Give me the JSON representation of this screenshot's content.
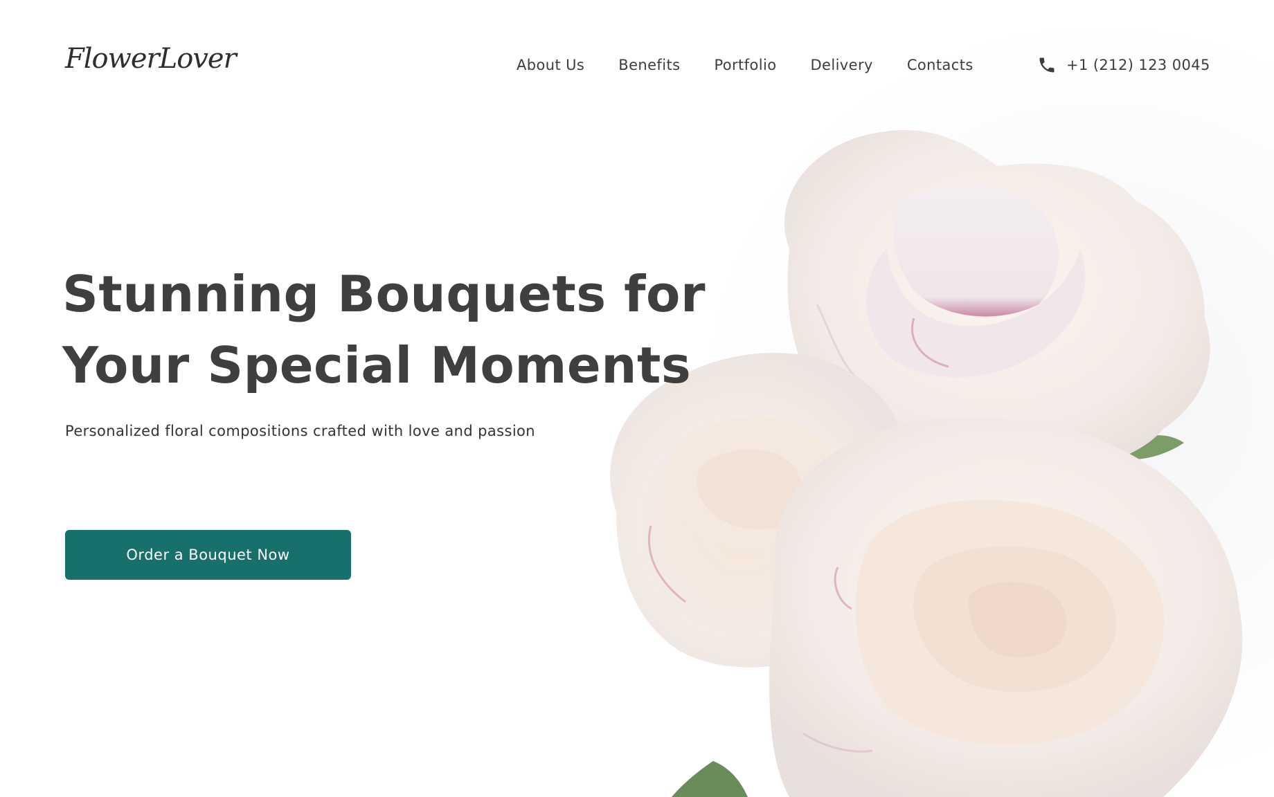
{
  "header": {
    "logo_text": "FlowerLover",
    "nav": [
      {
        "label": "About Us"
      },
      {
        "label": "Benefits"
      },
      {
        "label": "Portfolio"
      },
      {
        "label": "Delivery"
      },
      {
        "label": "Contacts"
      }
    ],
    "phone": {
      "icon": "phone-icon",
      "number": "+1 (212) 123 0045"
    }
  },
  "hero": {
    "title_line_1": "Stunning Bouquets for",
    "title_line_2": "Your Special Moments",
    "subtitle": "Personalized floral compositions crafted with love and passion",
    "cta_label": "Order a Bouquet Now"
  },
  "image": {
    "subject": "white-pink-peonies"
  },
  "colors": {
    "accent": "#17706c",
    "text_dark": "#3f3f3f",
    "background": "#ffffff",
    "petal": "#f6efec",
    "petal_edge": "#c98aa6",
    "leaf": "#5f8a4e"
  }
}
